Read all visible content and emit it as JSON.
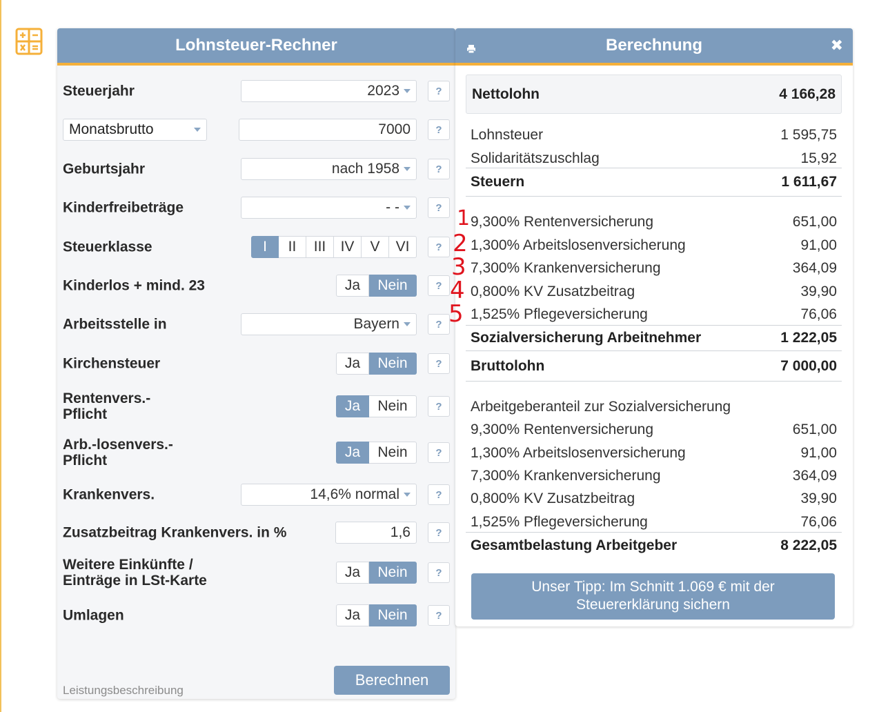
{
  "left": {
    "title": "Lohnsteuer-Rechner",
    "rows": {
      "steuerjahr": {
        "label": "Steuerjahr",
        "value": "2023"
      },
      "brutto": {
        "mode": "Monatsbrutto",
        "value": "7000"
      },
      "geburtsjahr": {
        "label": "Geburtsjahr",
        "value": "nach 1958"
      },
      "kinder": {
        "label": "Kinderfreibeträge",
        "value": "- -"
      },
      "steuerklasse": {
        "label": "Steuerklasse",
        "options": [
          "I",
          "II",
          "III",
          "IV",
          "V",
          "VI"
        ],
        "selected": "I"
      },
      "kinderlos": {
        "label": "Kinderlos + mind. 23",
        "yes": "Ja",
        "no": "Nein",
        "selected": "Nein"
      },
      "arbeitsstelle": {
        "label": "Arbeitsstelle in",
        "value": "Bayern"
      },
      "kirchensteuer": {
        "label": "Kirchensteuer",
        "yes": "Ja",
        "no": "Nein",
        "selected": "Nein"
      },
      "rentenvers": {
        "label_1": "Rentenvers.-",
        "label_2": "Pflicht",
        "yes": "Ja",
        "no": "Nein",
        "selected": "Ja"
      },
      "arblosenvers": {
        "label_1": "Arb.-losenvers.-",
        "label_2": "Pflicht",
        "yes": "Ja",
        "no": "Nein",
        "selected": "Ja"
      },
      "krankenvers": {
        "label": "Krankenvers.",
        "value": "14,6% normal"
      },
      "zusatzbeitrag": {
        "label": "Zusatzbeitrag Krankenvers. in %",
        "value": "1,6"
      },
      "weitere": {
        "label_1": "Weitere Einkünfte /",
        "label_2": "Einträge in LSt-Karte",
        "yes": "Ja",
        "no": "Nein",
        "selected": "Nein"
      },
      "umlagen": {
        "label": "Umlagen",
        "yes": "Ja",
        "no": "Nein",
        "selected": "Nein"
      }
    },
    "help_label": "?",
    "footer_link": "Leistungsbeschreibung",
    "calc_button": "Berechnen"
  },
  "right": {
    "title": "Berechnung",
    "close": "✖",
    "net": {
      "label": "Nettolohn",
      "value": "4 166,28"
    },
    "taxes": [
      {
        "label": "Lohnsteuer",
        "value": "1 595,75"
      },
      {
        "label": "Solidaritätszuschlag",
        "value": "15,92"
      }
    ],
    "taxes_total": {
      "label": "Steuern",
      "value": "1 611,67"
    },
    "employee_social": [
      {
        "label": "9,300% Rentenversicherung",
        "value": "651,00"
      },
      {
        "label": "1,300% Arbeitslosenversicherung",
        "value": "91,00"
      },
      {
        "label": "7,300% Krankenversicherung",
        "value": "364,09"
      },
      {
        "label": "0,800% KV Zusatzbeitrag",
        "value": "39,90"
      },
      {
        "label": "1,525% Pflegeversicherung",
        "value": "76,06"
      }
    ],
    "employee_social_total": {
      "label": "Sozialversicherung Arbeitnehmer",
      "value": "1 222,05"
    },
    "gross": {
      "label": "Bruttolohn",
      "value": "7 000,00"
    },
    "employer_heading": "Arbeitgeberanteil zur Sozialversicherung",
    "employer_social": [
      {
        "label": "9,300% Rentenversicherung",
        "value": "651,00"
      },
      {
        "label": "1,300% Arbeitslosenversicherung",
        "value": "91,00"
      },
      {
        "label": "7,300% Krankenversicherung",
        "value": "364,09"
      },
      {
        "label": "0,800% KV Zusatzbeitrag",
        "value": "39,90"
      },
      {
        "label": "1,525% Pflegeversicherung",
        "value": "76,06"
      }
    ],
    "employer_total": {
      "label": "Gesamtbelastung Arbeitgeber",
      "value": "8 222,05"
    },
    "tip_line_1": "Unser Tipp: Im Schnitt 1.069 € mit der",
    "tip_line_2": "Steuererklärung sichern"
  },
  "annotations": [
    "1",
    "2",
    "3",
    "4",
    "5"
  ],
  "colors": {
    "accent": "#7d9cbd",
    "orange": "#f5b03a",
    "annotation": "#e0141e"
  }
}
